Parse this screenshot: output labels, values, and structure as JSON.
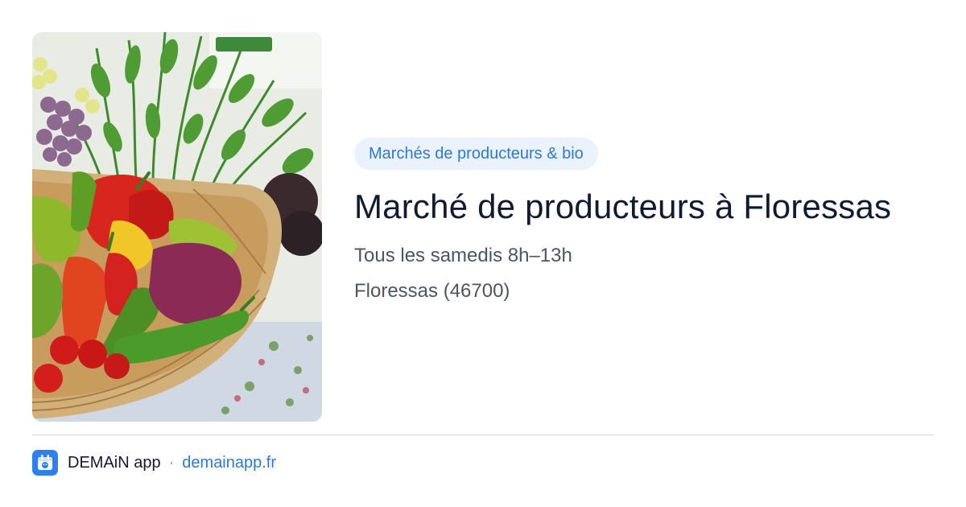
{
  "event": {
    "category": "Marchés de producteurs & bio",
    "title": "Marché de producteurs à Floressas",
    "schedule": "Tous les samedis 8h–13h",
    "location": "Floressas (46700)"
  },
  "photo": {
    "subject": "vegetables-basket-photo"
  },
  "footer": {
    "app_name": "DEMAiN app",
    "separator": "·",
    "url": "demainapp.fr",
    "icon": "demain-app-icon"
  },
  "colors": {
    "accent": "#2f78d6",
    "pill_background": "#eaf2fd",
    "title": "#101a33",
    "meta": "#4a5566",
    "divider": "#d5dde6",
    "app_icon": "#2e7ff0"
  }
}
